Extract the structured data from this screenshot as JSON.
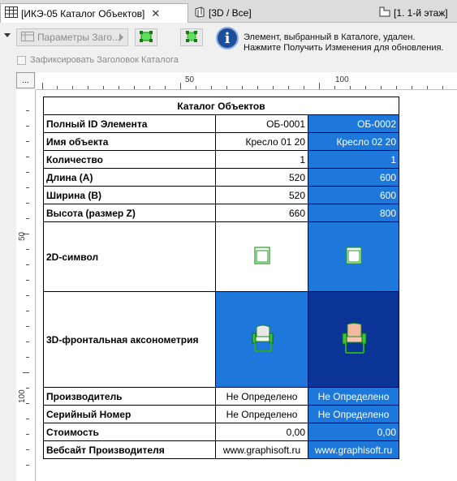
{
  "tabs": [
    {
      "label": "[ИКЭ-05 Каталог Объектов]",
      "close": "✕",
      "active": true
    },
    {
      "label": "[3D / Все]",
      "active": false
    },
    {
      "label": "[1. 1-й этаж]",
      "active": false
    }
  ],
  "toolbar": {
    "params_label": "Параметры Заго...",
    "info_line1": "Элемент, выбранный в Каталоге, удален.",
    "info_line2": "Нажмите Получить Изменения для обновления.",
    "fix_header_label": "Зафиксировать Заголовок Каталога",
    "fix_header_checked": false,
    "corner_label": "..."
  },
  "rulers": {
    "h_marks": [
      "50",
      "100"
    ],
    "v_marks": [
      "50",
      "100"
    ]
  },
  "catalog": {
    "title": "Каталог Объектов",
    "rows": [
      {
        "label": "Полный ID Элемента",
        "v1": "ОБ-0001",
        "v2": "ОБ-0002"
      },
      {
        "label": "Имя объекта",
        "v1": "Кресло 01 20",
        "v2": "Кресло 02 20"
      },
      {
        "label": "Количество",
        "v1": "1",
        "v2": "1"
      },
      {
        "label": "Длина (А)",
        "v1": "520",
        "v2": "600"
      },
      {
        "label": "Ширина (В)",
        "v1": "520",
        "v2": "600"
      },
      {
        "label": "Высота (размер Z)",
        "v1": "660",
        "v2": "800"
      }
    ],
    "symbol_2d_label": "2D-символ",
    "axon_3d_label": "3D-фронтальная аксонометрия",
    "rows_bottom": [
      {
        "label": "Производитель",
        "v1": "Не Определено",
        "v2": "Не Определено",
        "align": "center"
      },
      {
        "label": "Серийный Номер",
        "v1": "Не Определено",
        "v2": "Не Определено",
        "align": "center"
      },
      {
        "label": "Стоимость",
        "v1": "0,00",
        "v2": "0,00",
        "align": "right"
      },
      {
        "label": "Вебсайт Производителя",
        "v1": "www.graphisoft.ru",
        "v2": "www.graphisoft.ru",
        "align": "center"
      }
    ]
  },
  "colors": {
    "selected_column": "#1e78dc",
    "selected_3d_dark": "#0a3596",
    "info_icon": "#1a4f9c"
  }
}
